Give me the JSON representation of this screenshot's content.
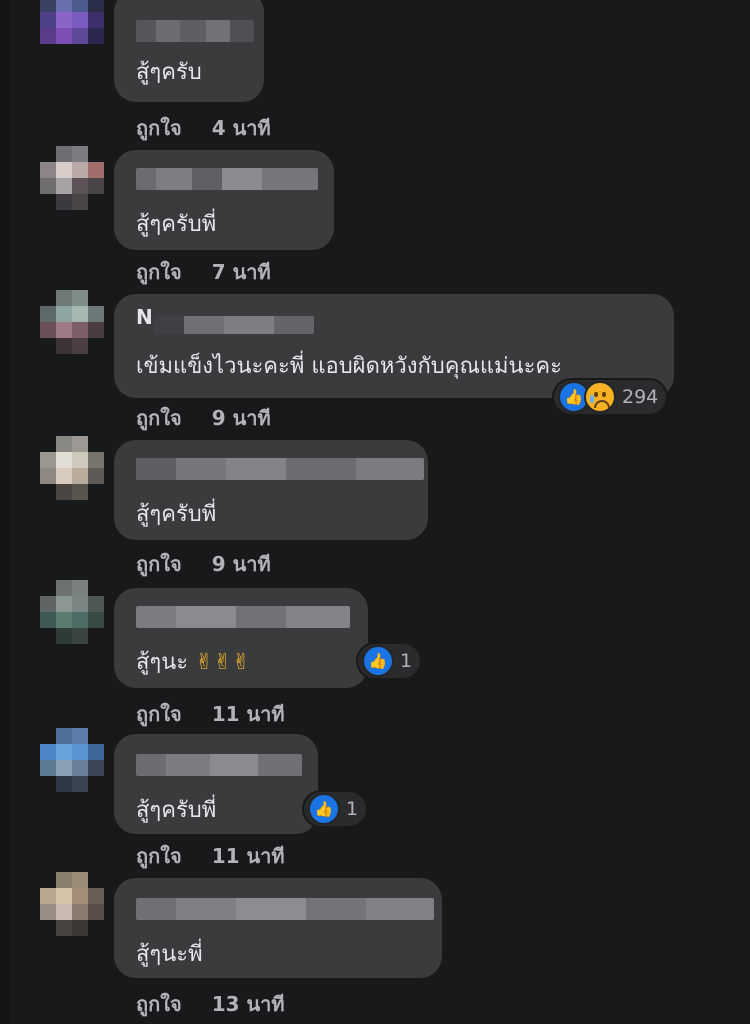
{
  "comments": [
    {
      "text": "สู้ๆครับ",
      "like": "ถูกใจ",
      "time": "4 นาที"
    },
    {
      "text": "สู้ๆครับพี่",
      "like": "ถูกใจ",
      "time": "7 นาที"
    },
    {
      "initial": "N",
      "text": "เข้มแข็งไวนะคะพี่ แอบผิดหวังกับคุณแม่นะคะ",
      "like": "ถูกใจ",
      "time": "9 นาที",
      "reaction_count": "294"
    },
    {
      "text": "สู้ๆครับพี่",
      "like": "ถูกใจ",
      "time": "9 นาที"
    },
    {
      "text": "สู้ๆนะ",
      "emoji": "✌✌✌",
      "like": "ถูกใจ",
      "time": "11 นาที",
      "reaction_count": "1"
    },
    {
      "text": "สู้ๆครับพี่",
      "like": "ถูกใจ",
      "time": "11 นาที",
      "reaction_count": "1"
    },
    {
      "text": "สู้ๆนะพี่",
      "like": "ถูกใจ",
      "time": "13 นาที"
    }
  ],
  "icons": {
    "like": "thumbs-up-icon",
    "sad": "sad-face-icon"
  },
  "colors": {
    "background": "#18191a",
    "bubble": "#3a3b3c",
    "like_blue": "#1b74e4",
    "secondary_text": "#b0b3b8"
  }
}
